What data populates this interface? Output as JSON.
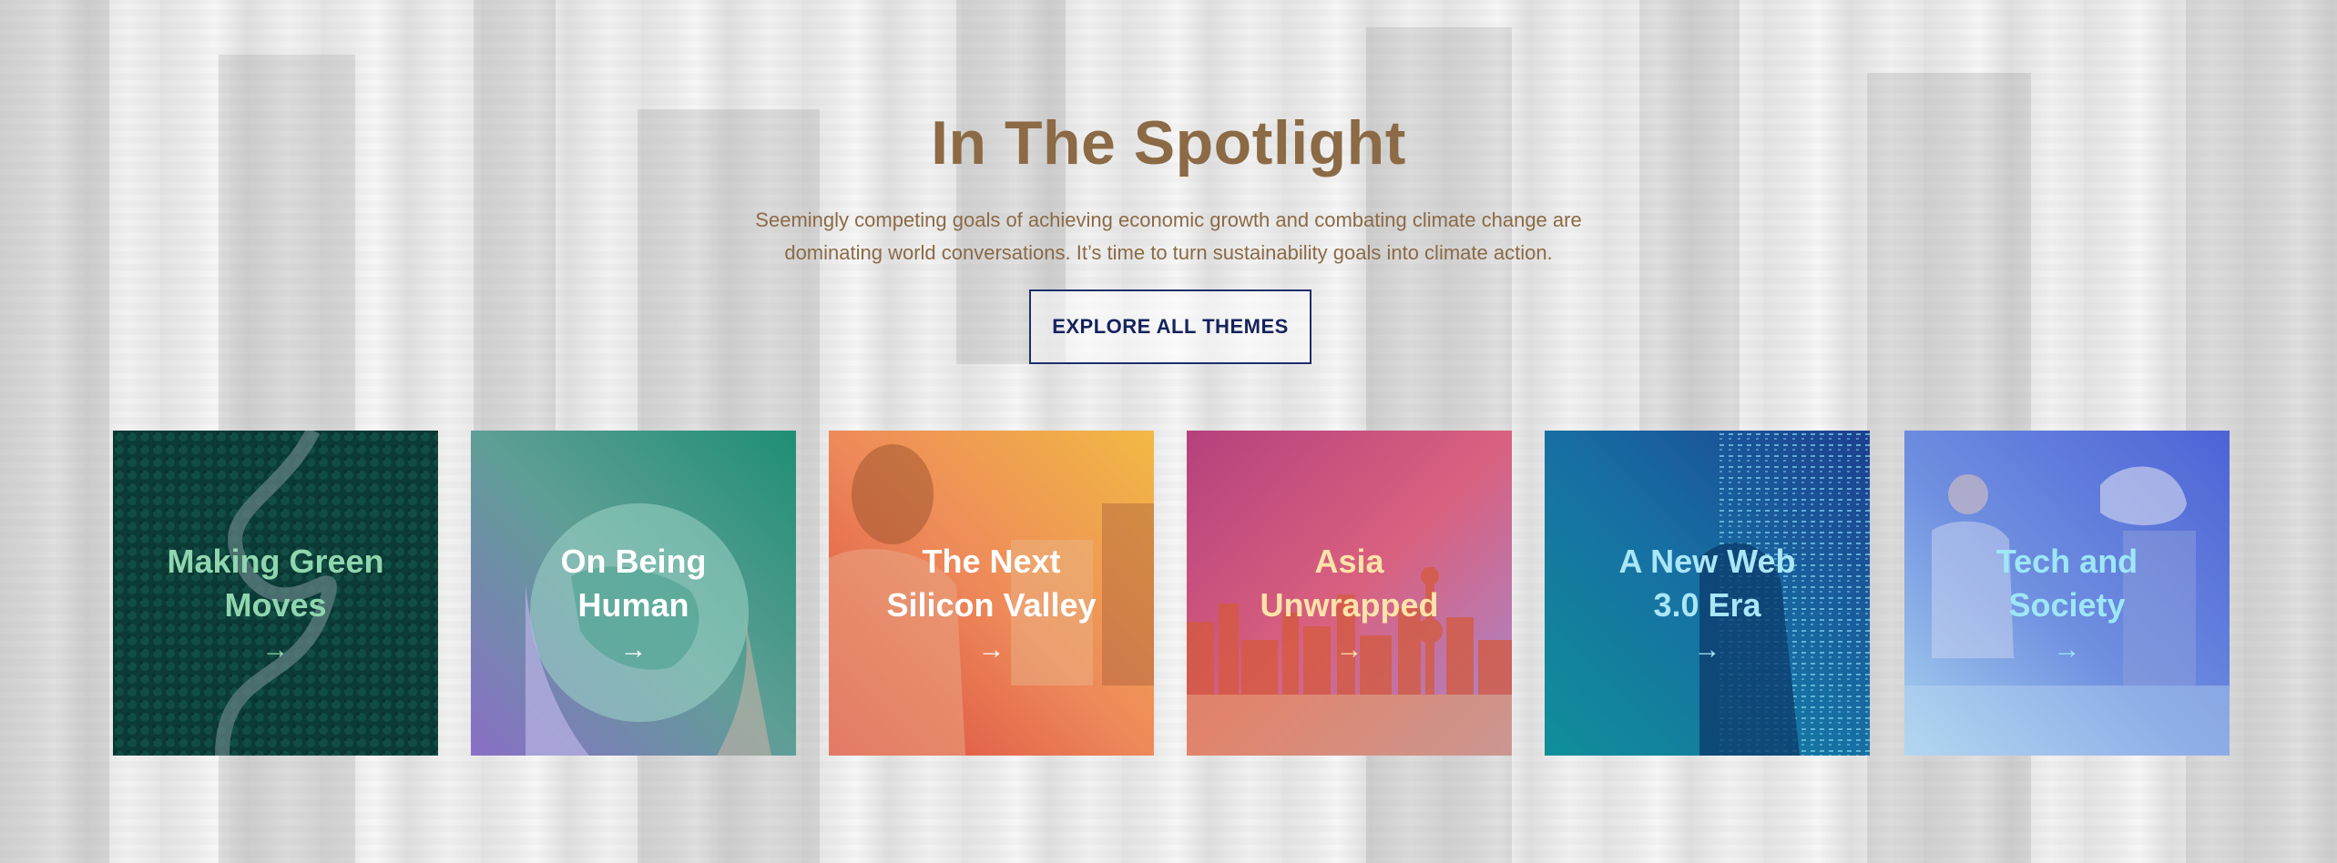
{
  "spotlight": {
    "title": "In The Spotlight",
    "subtitle_line1": "Seemingly competing goals of achieving economic growth and combating climate change are",
    "subtitle_line2": "dominating world conversations. It’s time to turn sustainability goals into climate action.",
    "explore_label": "EXPLORE ALL THEMES"
  },
  "cards": [
    {
      "line1": "Making Green",
      "line2": "Moves",
      "arrow": "→",
      "text_color": "#8fd6ae"
    },
    {
      "line1": "On Being",
      "line2": "Human",
      "arrow": "→",
      "text_color": "#ffffff"
    },
    {
      "line1": "The Next",
      "line2": "Silicon Valley",
      "arrow": "→",
      "text_color": "#ffffff"
    },
    {
      "line1": "Asia",
      "line2": "Unwrapped",
      "arrow": "→",
      "text_color": "#ffe3a8"
    },
    {
      "line1": "A New Web",
      "line2": "3.0 Era",
      "arrow": "→",
      "text_color": "#a9e6f7"
    },
    {
      "line1": "Tech and",
      "line2": "Society",
      "arrow": "→",
      "text_color": "#9ee7f7"
    }
  ],
  "colors": {
    "title": "#8b6a45",
    "button_border": "#1e2f6b"
  }
}
